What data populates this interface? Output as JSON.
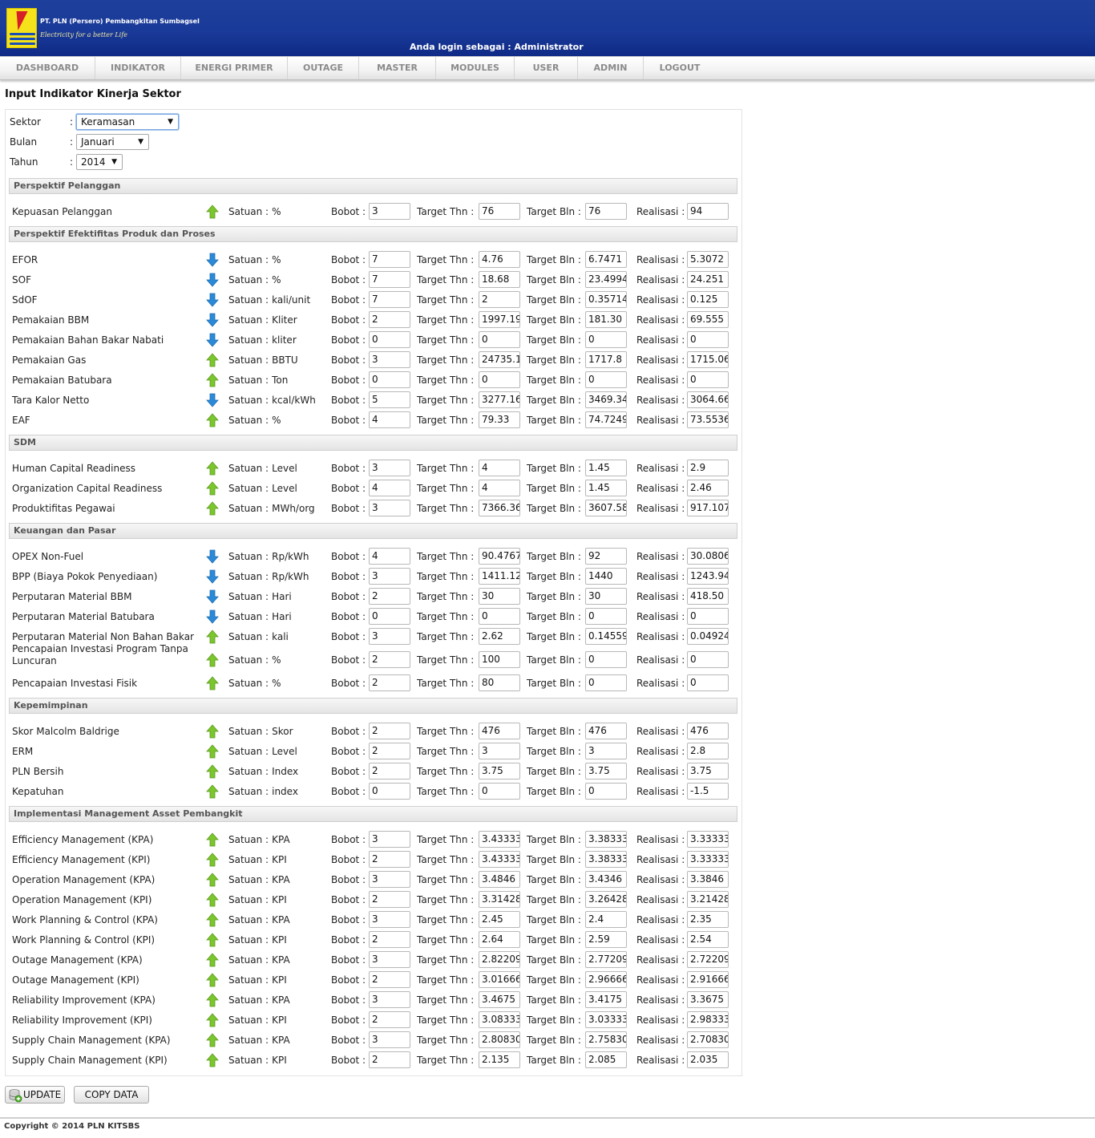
{
  "header": {
    "company": "PT. PLN (Persero) Pembangkitan Sumbagsel",
    "tagline": "Electricity for a better Life",
    "login_info": "Anda login sebagai : Administrator",
    "colors": {
      "header_blue": "#1a3a99",
      "logo_yellow": "#f6e21a",
      "logo_red": "#d61f26"
    }
  },
  "nav": [
    "DASHBOARD",
    "INDIKATOR",
    "ENERGI PRIMER",
    "OUTAGE",
    "MASTER",
    "MODULES",
    "USER",
    "ADMIN",
    "LOGOUT"
  ],
  "page_title": "Input Indikator Kinerja Sektor",
  "filters": [
    {
      "label": "Sektor",
      "value": "Keramasan"
    },
    {
      "label": "Bulan",
      "value": "Januari"
    },
    {
      "label": "Tahun",
      "value": "2014"
    }
  ],
  "labels": {
    "colon": ":",
    "satuan": "Satuan :",
    "bobot": "Bobot :",
    "target_thn": "Target Thn :",
    "target_bln": "Target Bln :",
    "realisasi": "Realisasi :"
  },
  "arrow_colors": {
    "up": "#7bc52d",
    "down": "#2b8ad8"
  },
  "sections": [
    {
      "title": "Perspektif Pelanggan",
      "rows": [
        {
          "name": "Kepuasan Pelanggan",
          "arrow": "up",
          "satuan": "%",
          "bobot": "3",
          "target_thn": "76",
          "target_bln": "76",
          "realisasi": "94"
        }
      ]
    },
    {
      "title": "Perspektif Efektifitas Produk dan Proses",
      "rows": [
        {
          "name": "EFOR",
          "arrow": "down",
          "satuan": "%",
          "bobot": "7",
          "target_thn": "4.76",
          "target_bln": "6.7471",
          "realisasi": "5.3072"
        },
        {
          "name": "SOF",
          "arrow": "down",
          "satuan": "%",
          "bobot": "7",
          "target_thn": "18.68",
          "target_bln": "23.4994",
          "realisasi": "24.251"
        },
        {
          "name": "SdOF",
          "arrow": "down",
          "satuan": "kali/unit",
          "bobot": "7",
          "target_thn": "2",
          "target_bln": "0.35714",
          "realisasi": "0.125"
        },
        {
          "name": "Pemakaian BBM",
          "arrow": "down",
          "satuan": "Kliter",
          "bobot": "2",
          "target_thn": "1997.19",
          "target_bln": "181.30",
          "realisasi": "69.555"
        },
        {
          "name": "Pemakaian Bahan Bakar Nabati",
          "arrow": "down",
          "satuan": "kliter",
          "bobot": "0",
          "target_thn": "0",
          "target_bln": "0",
          "realisasi": "0"
        },
        {
          "name": "Pemakaian Gas",
          "arrow": "up",
          "satuan": "BBTU",
          "bobot": "3",
          "target_thn": "24735.1",
          "target_bln": "1717.8",
          "realisasi": "1715.06"
        },
        {
          "name": "Pemakaian Batubara",
          "arrow": "up",
          "satuan": "Ton",
          "bobot": "0",
          "target_thn": "0",
          "target_bln": "0",
          "realisasi": "0"
        },
        {
          "name": "Tara Kalor Netto",
          "arrow": "down",
          "satuan": "kcal/kWh",
          "bobot": "5",
          "target_thn": "3277.16",
          "target_bln": "3469.34",
          "realisasi": "3064.66"
        },
        {
          "name": "EAF",
          "arrow": "up",
          "satuan": "%",
          "bobot": "4",
          "target_thn": "79.33",
          "target_bln": "74.7249",
          "realisasi": "73.5536"
        }
      ]
    },
    {
      "title": "SDM",
      "rows": [
        {
          "name": "Human Capital Readiness",
          "arrow": "up",
          "satuan": "Level",
          "bobot": "3",
          "target_thn": "4",
          "target_bln": "1.45",
          "realisasi": "2.9"
        },
        {
          "name": "Organization Capital Readiness",
          "arrow": "up",
          "satuan": "Level",
          "bobot": "4",
          "target_thn": "4",
          "target_bln": "1.45",
          "realisasi": "2.46"
        },
        {
          "name": "Produktifitas Pegawai",
          "arrow": "up",
          "satuan": "MWh/org",
          "bobot": "3",
          "target_thn": "7366.36",
          "target_bln": "3607.58",
          "realisasi": "917.107"
        }
      ]
    },
    {
      "title": "Keuangan dan Pasar",
      "rows": [
        {
          "name": "OPEX Non-Fuel",
          "arrow": "down",
          "satuan": "Rp/kWh",
          "bobot": "4",
          "target_thn": "90.4767",
          "target_bln": "92",
          "realisasi": "30.0806"
        },
        {
          "name": "BPP (Biaya Pokok Penyediaan)",
          "arrow": "down",
          "satuan": "Rp/kWh",
          "bobot": "3",
          "target_thn": "1411.12",
          "target_bln": "1440",
          "realisasi": "1243.94"
        },
        {
          "name": "Perputaran Material BBM",
          "arrow": "down",
          "satuan": "Hari",
          "bobot": "2",
          "target_thn": "30",
          "target_bln": "30",
          "realisasi": "418.50"
        },
        {
          "name": "Perputaran Material Batubara",
          "arrow": "down",
          "satuan": "Hari",
          "bobot": "0",
          "target_thn": "0",
          "target_bln": "0",
          "realisasi": "0"
        },
        {
          "name": "Perputaran Material Non Bahan Bakar",
          "arrow": "up",
          "satuan": "kali",
          "bobot": "3",
          "target_thn": "2.62",
          "target_bln": "0.14559",
          "realisasi": "0.04924"
        },
        {
          "name": "Pencapaian Investasi Program Tanpa Luncuran",
          "arrow": "up",
          "satuan": "%",
          "bobot": "2",
          "target_thn": "100",
          "target_bln": "0",
          "realisasi": "0",
          "tall": true
        },
        {
          "name": "Pencapaian Investasi Fisik",
          "arrow": "up",
          "satuan": "%",
          "bobot": "2",
          "target_thn": "80",
          "target_bln": "0",
          "realisasi": "0"
        }
      ]
    },
    {
      "title": "Kepemimpinan",
      "rows": [
        {
          "name": "Skor Malcolm Baldrige",
          "arrow": "up",
          "satuan": "Skor",
          "bobot": "2",
          "target_thn": "476",
          "target_bln": "476",
          "realisasi": "476"
        },
        {
          "name": "ERM",
          "arrow": "up",
          "satuan": "Level",
          "bobot": "2",
          "target_thn": "3",
          "target_bln": "3",
          "realisasi": "2.8"
        },
        {
          "name": "PLN Bersih",
          "arrow": "up",
          "satuan": "Index",
          "bobot": "2",
          "target_thn": "3.75",
          "target_bln": "3.75",
          "realisasi": "3.75"
        },
        {
          "name": "Kepatuhan",
          "arrow": "up",
          "satuan": "index",
          "bobot": "0",
          "target_thn": "0",
          "target_bln": "0",
          "realisasi": "-1.5"
        }
      ]
    },
    {
      "title": "Implementasi Management Asset Pembangkit",
      "rows": [
        {
          "name": "Efficiency Management (KPA)",
          "arrow": "up",
          "satuan": "KPA",
          "bobot": "3",
          "target_thn": "3.43333",
          "target_bln": "3.38333",
          "realisasi": "3.33333"
        },
        {
          "name": "Efficiency Management (KPI)",
          "arrow": "up",
          "satuan": "KPI",
          "bobot": "2",
          "target_thn": "3.43333",
          "target_bln": "3.38333",
          "realisasi": "3.33333"
        },
        {
          "name": "Operation Management (KPA)",
          "arrow": "up",
          "satuan": "KPA",
          "bobot": "3",
          "target_thn": "3.4846",
          "target_bln": "3.4346",
          "realisasi": "3.3846"
        },
        {
          "name": "Operation Management (KPI)",
          "arrow": "up",
          "satuan": "KPI",
          "bobot": "2",
          "target_thn": "3.31428",
          "target_bln": "3.26428",
          "realisasi": "3.21428"
        },
        {
          "name": "Work Planning & Control (KPA)",
          "arrow": "up",
          "satuan": "KPA",
          "bobot": "3",
          "target_thn": "2.45",
          "target_bln": "2.4",
          "realisasi": "2.35"
        },
        {
          "name": "Work Planning & Control (KPI)",
          "arrow": "up",
          "satuan": "KPI",
          "bobot": "2",
          "target_thn": "2.64",
          "target_bln": "2.59",
          "realisasi": "2.54"
        },
        {
          "name": "Outage Management (KPA)",
          "arrow": "up",
          "satuan": "KPA",
          "bobot": "3",
          "target_thn": "2.82209",
          "target_bln": "2.77209",
          "realisasi": "2.72209"
        },
        {
          "name": "Outage Management (KPI)",
          "arrow": "up",
          "satuan": "KPI",
          "bobot": "2",
          "target_thn": "3.01666",
          "target_bln": "2.96666",
          "realisasi": "2.91666"
        },
        {
          "name": "Reliability Improvement (KPA)",
          "arrow": "up",
          "satuan": "KPA",
          "bobot": "3",
          "target_thn": "3.4675",
          "target_bln": "3.4175",
          "realisasi": "3.3675"
        },
        {
          "name": "Reliability Improvement (KPI)",
          "arrow": "up",
          "satuan": "KPI",
          "bobot": "2",
          "target_thn": "3.08333",
          "target_bln": "3.03333",
          "realisasi": "2.98333"
        },
        {
          "name": "Supply Chain Management (KPA)",
          "arrow": "up",
          "satuan": "KPA",
          "bobot": "3",
          "target_thn": "2.80830",
          "target_bln": "2.75830",
          "realisasi": "2.70830"
        },
        {
          "name": "Supply Chain Management (KPI)",
          "arrow": "up",
          "satuan": "KPI",
          "bobot": "2",
          "target_thn": "2.135",
          "target_bln": "2.085",
          "realisasi": "2.035"
        }
      ]
    }
  ],
  "buttons": {
    "update": "UPDATE",
    "copy": "COPY DATA"
  },
  "footer": "Copyright © 2014 PLN KITSBS"
}
